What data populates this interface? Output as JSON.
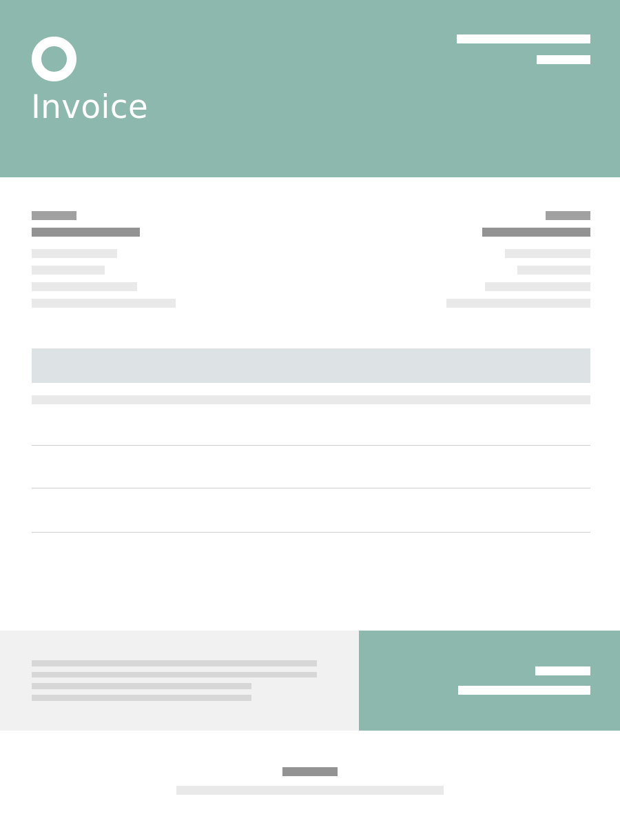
{
  "header": {
    "title": "Invoice",
    "logo_icon": "circle-ring-logo",
    "background_color": "#8cb8ad"
  },
  "table": {
    "header_color": "#dde2e5",
    "row_count": 3
  },
  "totals": {
    "background_color": "#8cb8ad"
  },
  "notes": {
    "background_color": "#f1f1f1"
  }
}
